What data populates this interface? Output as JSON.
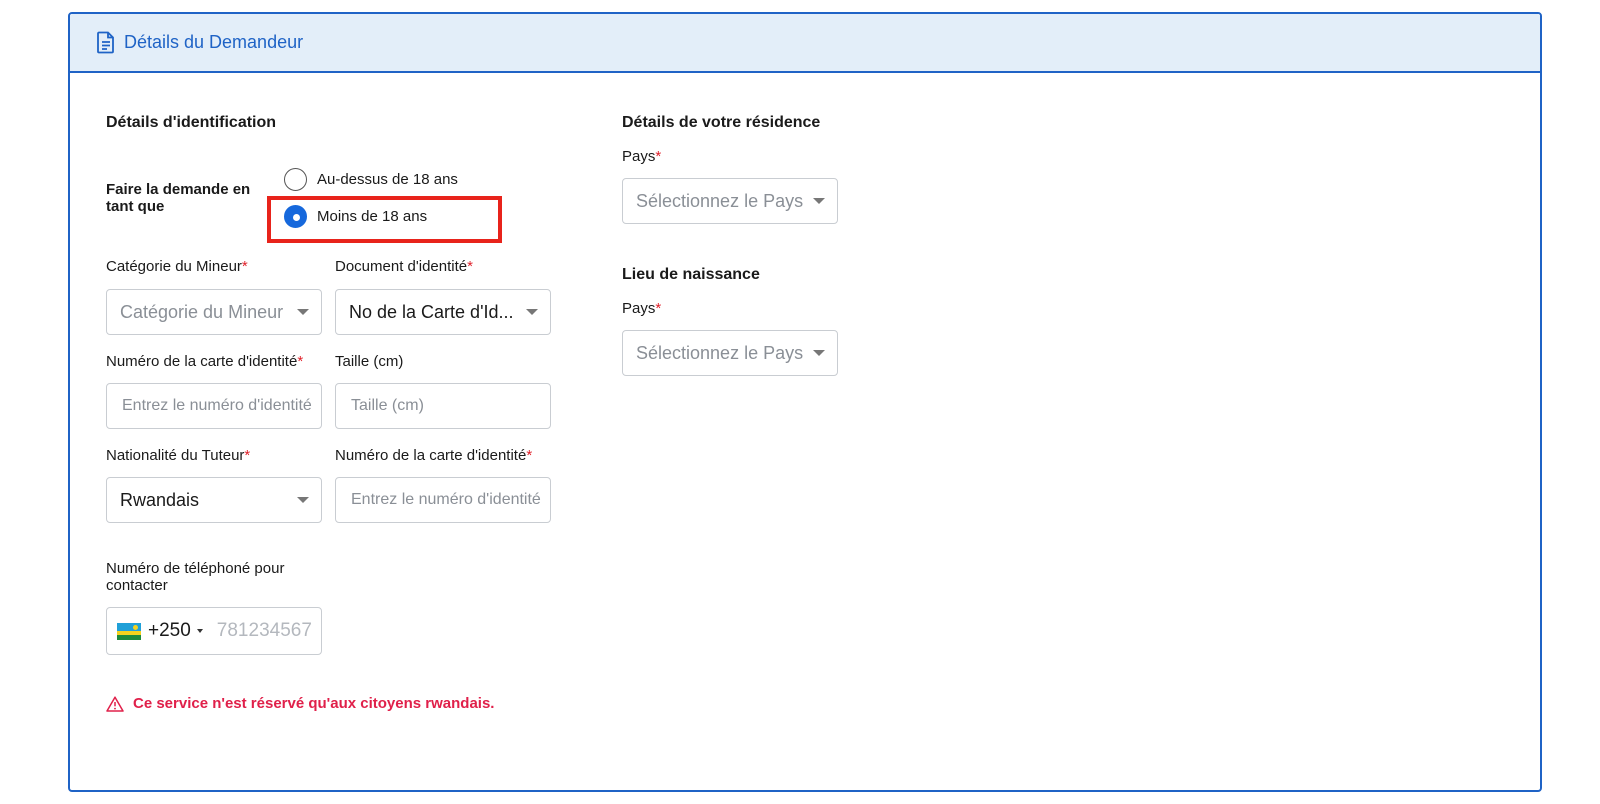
{
  "header": {
    "title": "Détails du Demandeur",
    "icon": "document-icon"
  },
  "identification": {
    "title": "Détails d'identification",
    "apply_as": {
      "label": "Faire la demande en tant que",
      "options": [
        "Au-dessus de 18 ans",
        "Moins de 18 ans"
      ],
      "selected": "Moins de 18 ans"
    },
    "minor_category": {
      "label": "Catégorie du Mineur",
      "required": "*",
      "placeholder": "Catégorie du Mineur"
    },
    "id_document": {
      "label": "Document d'identité",
      "required": "*",
      "value": "No de la Carte d'Id..."
    },
    "id_number": {
      "label": "Numéro de la carte d'identité",
      "required": "*",
      "placeholder": "Entrez le numéro d'identité"
    },
    "height": {
      "label": "Taille (cm)",
      "placeholder": "Taille (cm)"
    },
    "guardian_nationality": {
      "label": "Nationalité du Tuteur",
      "required": "*",
      "value": "Rwandais"
    },
    "guardian_id_number": {
      "label": "Numéro de la carte d'identité",
      "required": "*",
      "placeholder": "Entrez le numéro d'identité"
    },
    "phone": {
      "label": "Numéro de téléphoné pour contacter",
      "dial_code": "+250",
      "placeholder": "781234567",
      "flag": "rwanda-flag-icon"
    },
    "warning": "Ce service n'est réservé qu'aux citoyens rwandais."
  },
  "residence": {
    "title": "Détails de votre résidence",
    "country": {
      "label": "Pays",
      "required": "*",
      "placeholder": "Sélectionnez le Pays"
    }
  },
  "birthplace": {
    "title": "Lieu de naissance",
    "country": {
      "label": "Pays",
      "required": "*",
      "placeholder": "Sélectionnez le Pays"
    }
  },
  "colors": {
    "primary": "#1f63c6",
    "header_bg": "#e3eef9",
    "required": "#e0202a",
    "warning": "#e0204a",
    "highlight": "#e8231b",
    "radio_checked": "#1668dc"
  }
}
